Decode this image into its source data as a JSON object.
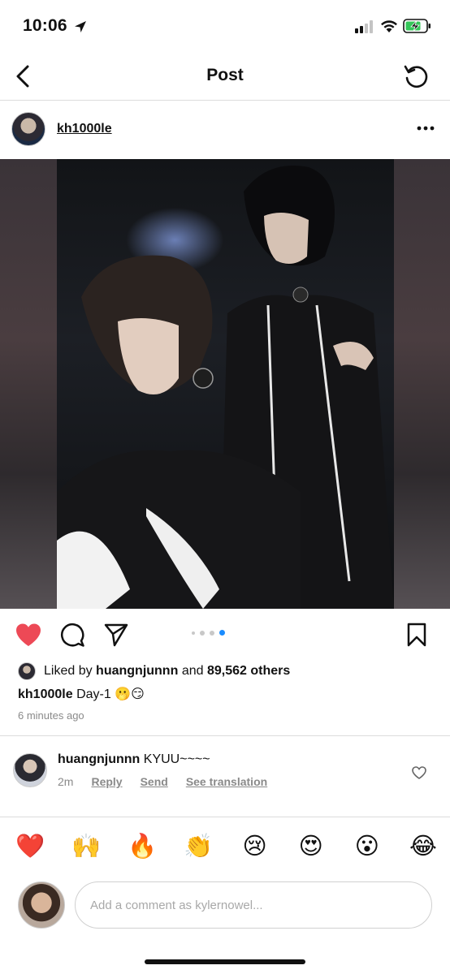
{
  "status": {
    "time": "10:06"
  },
  "nav": {
    "title": "Post"
  },
  "post": {
    "author": "kh1000le",
    "carousel": {
      "total": 4,
      "active_index": 3
    },
    "likes": {
      "prefix": "Liked by",
      "liker": "huangnjunnn",
      "and": "and",
      "count_text": "89,562 others"
    },
    "caption": {
      "user": "kh1000le",
      "text": "Day-1 🫢😏"
    },
    "time_ago": "6 minutes ago"
  },
  "comment": {
    "user": "huangnjunnn",
    "text": "KYUU~~~~",
    "age": "2m",
    "reply_label": "Reply",
    "send_label": "Send",
    "translate_label": "See translation"
  },
  "emojis": [
    "❤️",
    "🙌",
    "🔥",
    "👏",
    "😢",
    "😍",
    "😮",
    "😂"
  ],
  "composer": {
    "placeholder": "Add a comment as kylernowel..."
  },
  "colors": {
    "like_red": "#ed4956",
    "carousel_blue": "#1a8cff"
  }
}
